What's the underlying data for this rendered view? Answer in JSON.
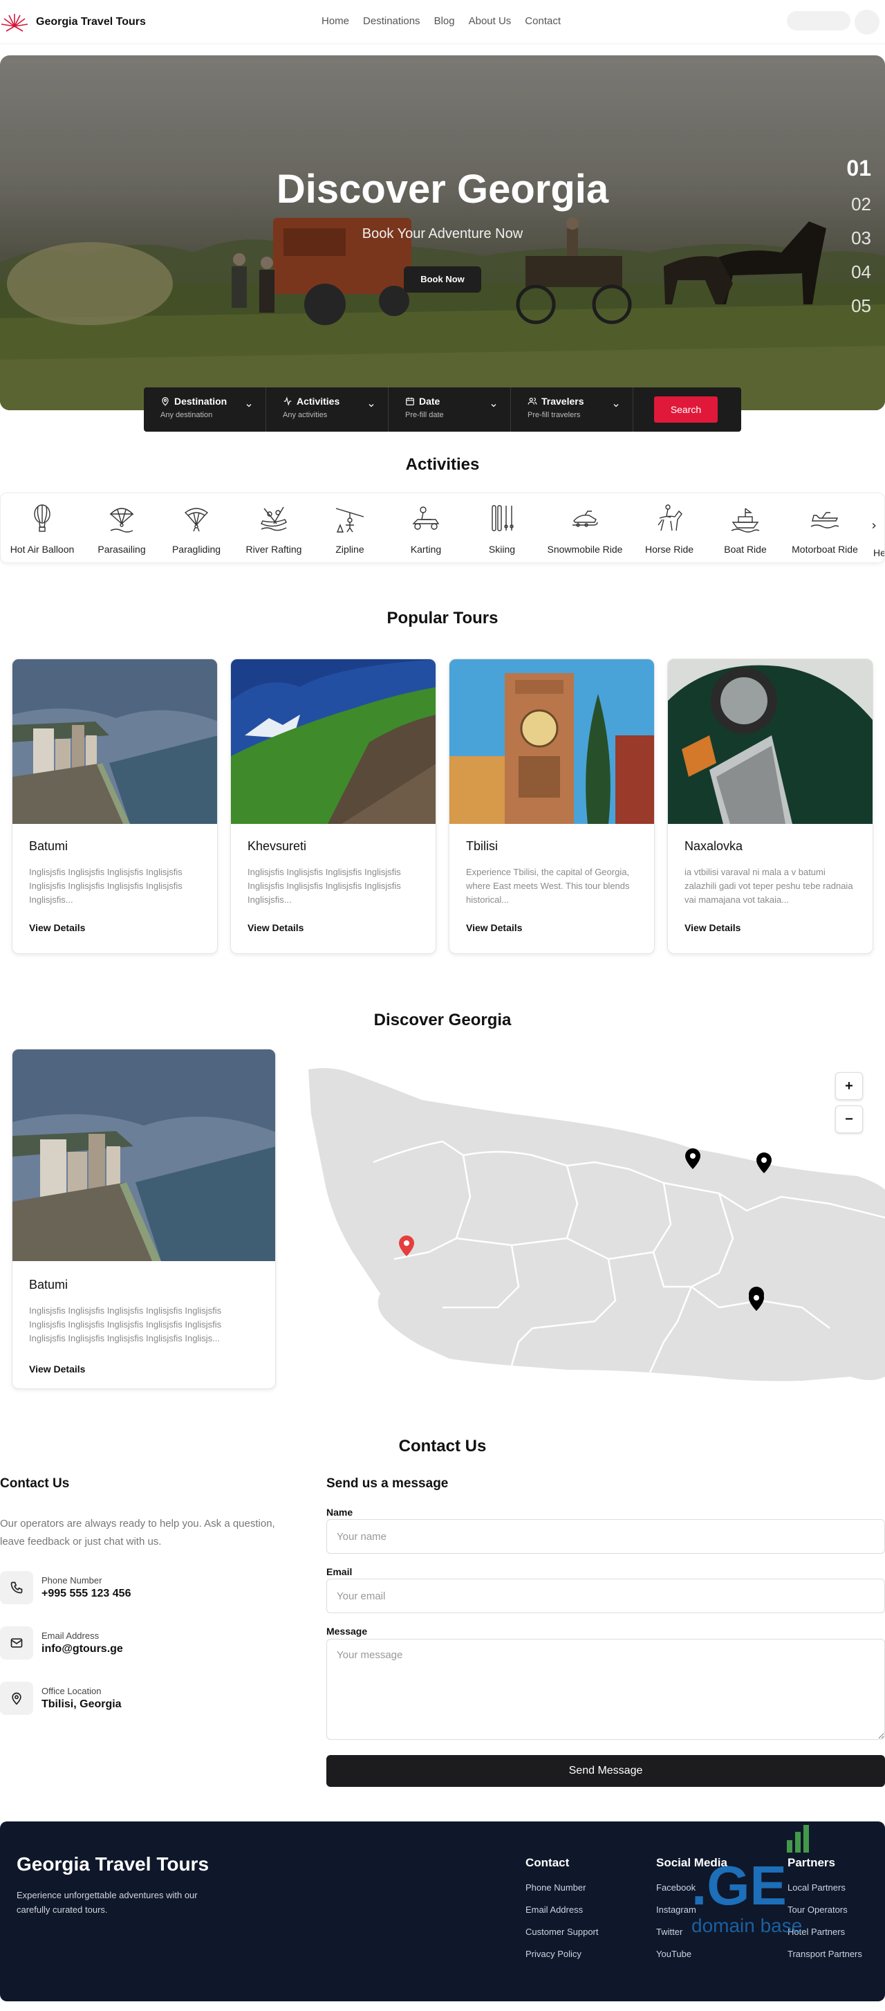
{
  "header": {
    "brand": "Georgia Travel Tours",
    "nav": [
      "Home",
      "Destinations",
      "Blog",
      "About Us",
      "Contact"
    ]
  },
  "hero": {
    "title": "Discover Georgia",
    "subtitle": "Book Your Adventure Now",
    "cta": "Book Now",
    "slides": [
      "01",
      "02",
      "03",
      "04",
      "05"
    ],
    "active_slide": "01"
  },
  "search": {
    "fields": [
      {
        "label": "Destination",
        "sub": "Any destination",
        "icon": "map-pin-icon"
      },
      {
        "label": "Activities",
        "sub": "Any activities",
        "icon": "activity-icon"
      },
      {
        "label": "Date",
        "sub": "Pre-fill date",
        "icon": "calendar-icon"
      },
      {
        "label": "Travelers",
        "sub": "Pre-fill travelers",
        "icon": "users-icon"
      }
    ],
    "button": "Search"
  },
  "activities": {
    "title": "Activities",
    "items": [
      "Hot Air Balloon",
      "Parasailing",
      "Paragliding",
      "River Rafting",
      "Zipline",
      "Karting",
      "Skiing",
      "Snowmobile Ride",
      "Horse Ride",
      "Boat Ride",
      "Motorboat Ride",
      "He"
    ]
  },
  "tours": {
    "title": "Popular Tours",
    "cards": [
      {
        "name": "Batumi",
        "desc": "Inglisjsfis Inglisjsfis Inglisjsfis Inglisjsfis Inglisjsfis Inglisjsfis Inglisjsfis Inglisjsfis Inglisjsfis...",
        "link": "View Details"
      },
      {
        "name": "Khevsureti",
        "desc": "Inglisjsfis Inglisjsfis Inglisjsfis Inglisjsfis Inglisjsfis Inglisjsfis Inglisjsfis Inglisjsfis Inglisjsfis...",
        "link": "View Details"
      },
      {
        "name": "Tbilisi",
        "desc": "Experience Tbilisi, the capital of Georgia, where East meets West. This tour blends historical...",
        "link": "View Details"
      },
      {
        "name": "Naxalovka",
        "desc": "ia vtbilisi varaval ni mala a v batumi zalazhili gadi vot teper peshu tebe radnaia vai mamajana vot takaia...",
        "link": "View Details"
      }
    ]
  },
  "discover": {
    "title": "Discover Georgia",
    "card": {
      "name": "Batumi",
      "desc": "Inglisjsfis Inglisjsfis Inglisjsfis Inglisjsfis Inglisjsfis Inglisjsfis Inglisjsfis Inglisjsfis Inglisjsfis Inglisjsfis Inglisjsfis Inglisjsfis Inglisjsfis Inglisjsfis Inglisjs...",
      "link": "View Details"
    },
    "zoom_in": "+",
    "zoom_out": "−"
  },
  "contact": {
    "title": "Contact Us",
    "left_title": "Contact Us",
    "intro": "Our operators are always ready to help you. Ask a question, leave feedback or just chat with us.",
    "items": [
      {
        "label": "Phone Number",
        "value": "+995 555 123 456",
        "icon": "phone-icon"
      },
      {
        "label": "Email Address",
        "value": "info@gtours.ge",
        "icon": "mail-icon"
      },
      {
        "label": "Office Location",
        "value": "Tbilisi, Georgia",
        "icon": "map-pin-icon"
      }
    ],
    "form": {
      "title": "Send us a message",
      "name_label": "Name",
      "name_placeholder": "Your name",
      "email_label": "Email",
      "email_placeholder": "Your email",
      "message_label": "Message",
      "message_placeholder": "Your message",
      "submit": "Send Message"
    }
  },
  "footer": {
    "brand": "Georgia Travel Tours",
    "tagline": "Experience unforgettable adventures with our carefully curated tours.",
    "columns": [
      {
        "title": "Contact",
        "links": [
          "Phone Number",
          "Email Address",
          "Customer Support",
          "Privacy Policy"
        ]
      },
      {
        "title": "Social Media",
        "links": [
          "Facebook",
          "Instagram",
          "Twitter",
          "YouTube"
        ]
      },
      {
        "title": "Partners",
        "links": [
          "Local Partners",
          "Tour Operators",
          "Hotel Partners",
          "Transport Partners"
        ]
      }
    ],
    "watermark_big": ".GE",
    "watermark_small": "domain base"
  },
  "colors": {
    "accent": "#e0193a",
    "dark": "#1c1c1e",
    "footer_bg": "#0f172a",
    "map_land": "#e0e0e0"
  }
}
